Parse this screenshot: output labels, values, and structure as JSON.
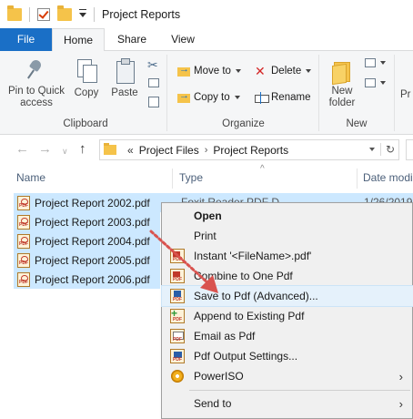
{
  "window": {
    "title": "Project Reports"
  },
  "tabs": [
    {
      "label": "File"
    },
    {
      "label": "Home"
    },
    {
      "label": "Share"
    },
    {
      "label": "View"
    }
  ],
  "ribbon": {
    "clipboard": {
      "label": "Clipboard",
      "pin_label_1": "Pin to Quick",
      "pin_label_2": "access",
      "copy_label": "Copy",
      "paste_label": "Paste"
    },
    "organize": {
      "label": "Organize",
      "move_to": "Move to",
      "copy_to": "Copy to",
      "delete": "Delete",
      "rename": "Rename"
    },
    "new": {
      "label": "New",
      "new_folder_1": "New",
      "new_folder_2": "folder"
    },
    "open": {
      "partial": "Pr"
    }
  },
  "address": {
    "overflow": "«",
    "crumbs": [
      "Project Files",
      "Project Reports"
    ]
  },
  "columns": {
    "name": "Name",
    "type": "Type",
    "date": "Date modi"
  },
  "files": [
    {
      "name": "Project Report 2002.pdf",
      "type_partial": "Foxit Reader PDF D...",
      "date_partial": "1/26/2019"
    },
    {
      "name": "Project Report 2003.pdf"
    },
    {
      "name": "Project Report 2004.pdf"
    },
    {
      "name": "Project Report 2005.pdf"
    },
    {
      "name": "Project Report 2006.pdf"
    }
  ],
  "context_menu": {
    "open": "Open",
    "print": "Print",
    "instant": "Instant '<FileName>.pdf'",
    "combine": "Combine to One Pdf",
    "save_advanced": "Save to Pdf (Advanced)...",
    "append": "Append to Existing Pdf",
    "email": "Email as Pdf",
    "settings": "Pdf Output Settings...",
    "poweriso": "PowerISO",
    "send_to": "Send to"
  },
  "colors": {
    "accent": "#1a6fc6",
    "selection": "#cce8ff",
    "menu_highlight": "#e5f1fb",
    "drag_arrow": "#d9534f"
  }
}
